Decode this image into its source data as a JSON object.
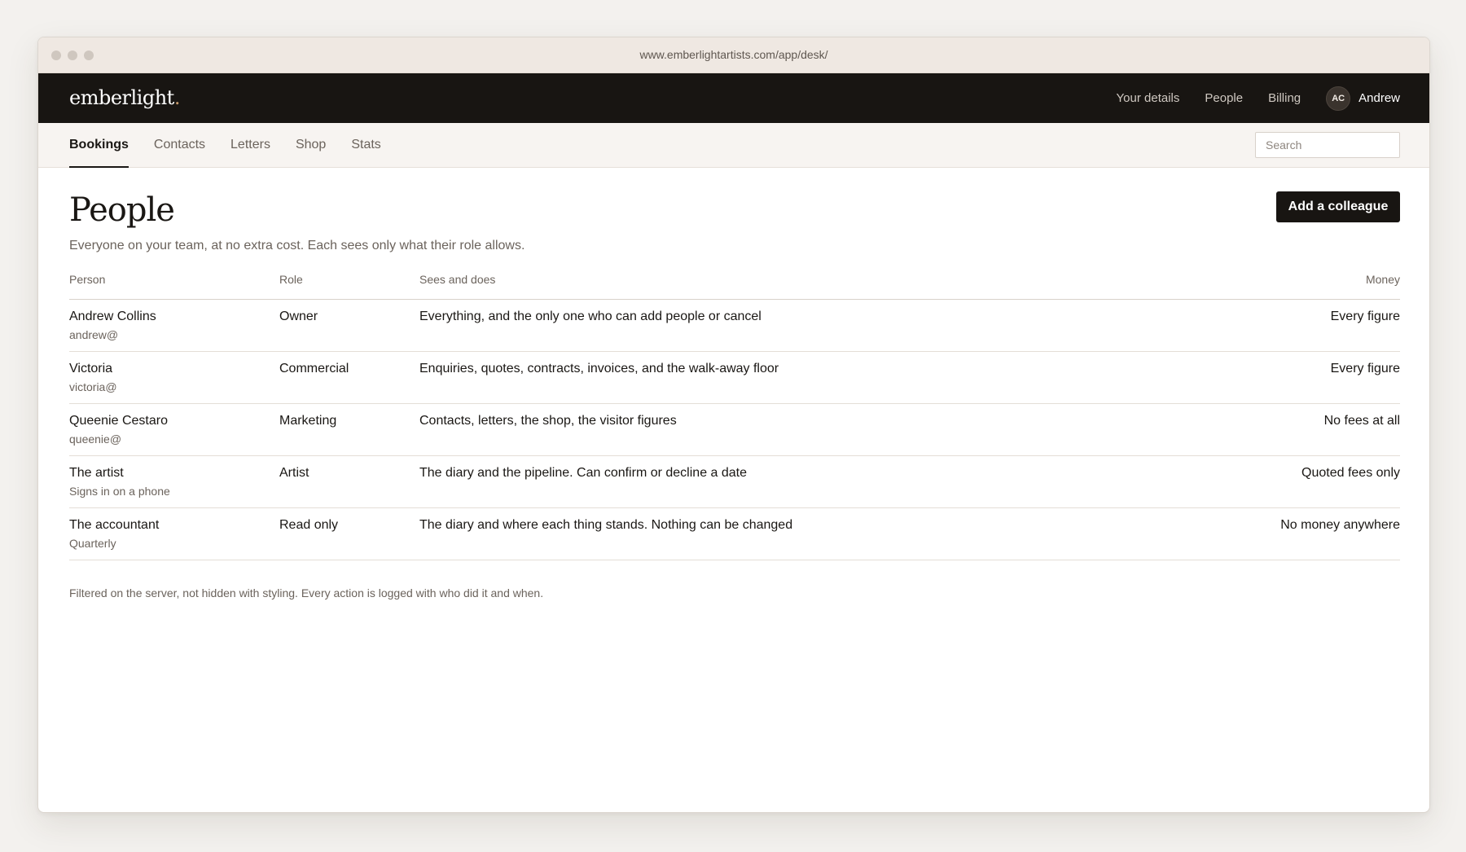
{
  "browser": {
    "url": "www.emberlightartists.com/app/desk/"
  },
  "app": {
    "logo": "emberlight",
    "logo_dot": ".",
    "accent_color": "#c79a6b",
    "nav": {
      "your_details": "Your details",
      "people": "People",
      "billing": "Billing"
    },
    "user": {
      "initials": "AC",
      "name": "Andrew"
    }
  },
  "tabs": [
    "Bookings",
    "Contacts",
    "Letters",
    "Shop",
    "Stats"
  ],
  "active_tab": "Bookings",
  "search": {
    "placeholder": "Search",
    "value": ""
  },
  "main": {
    "title": "People",
    "add_button": "Add a colleague",
    "subtitle": "Everyone on your team, at no extra cost. Each sees only what their role allows.",
    "table": {
      "columns": [
        "Person",
        "Role",
        "Sees and does",
        "Money"
      ],
      "rows": [
        {
          "name": "Andrew Collins",
          "sub": "andrew@",
          "role": "Owner",
          "sees": "Everything, and the only one who can add people or cancel",
          "money": "Every figure"
        },
        {
          "name": "Victoria",
          "sub": "victoria@",
          "role": "Commercial",
          "sees": "Enquiries, quotes, contracts, invoices, and the walk-away floor",
          "money": "Every figure"
        },
        {
          "name": "Queenie Cestaro",
          "sub": "queenie@",
          "role": "Marketing",
          "sees": "Contacts, letters, the shop, the visitor figures",
          "money": "No fees at all"
        },
        {
          "name": "The artist",
          "sub": "Signs in on a phone",
          "role": "Artist",
          "sees": "The diary and the pipeline. Can confirm or decline a date",
          "money": "Quoted fees only"
        },
        {
          "name": "The accountant",
          "sub": "Quarterly",
          "role": "Read only",
          "sees": "The diary and where each thing stands. Nothing can be changed",
          "money": "No money anywhere"
        }
      ]
    },
    "footnote": "Filtered on the server, not hidden with styling. Every action is logged with who did it and when."
  }
}
